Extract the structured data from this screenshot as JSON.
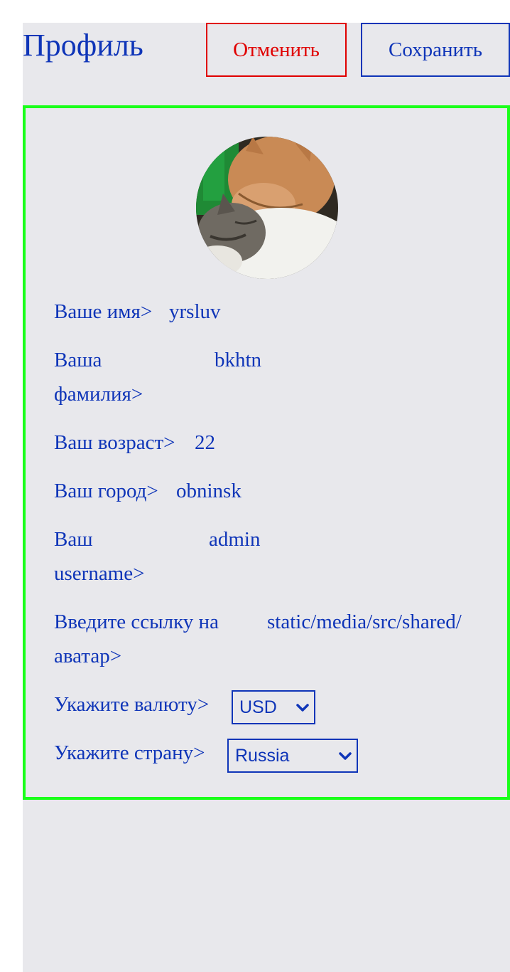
{
  "header": {
    "title": "Профиль",
    "cancel_label": "Отменить",
    "save_label": "Сохранить"
  },
  "colors": {
    "accent": "#0f35b8",
    "cancel": "#e00000",
    "card_border": "#1aff1a",
    "background": "#e8e8ec"
  },
  "profile": {
    "avatar_alt": "cats-avatar",
    "fields": [
      {
        "label": "Ваше имя>",
        "value": "yrsluv"
      },
      {
        "label_line1": "Ваша",
        "label_line2": "фамилия>",
        "value": "bkhtn"
      },
      {
        "label": "Ваш возраст>",
        "value": "22"
      },
      {
        "label": "Ваш город>",
        "value": "obninsk"
      },
      {
        "label_line1": "Ваш",
        "label_line2": "username>",
        "value": "admin"
      },
      {
        "label_line1": "Введите ссылку на",
        "label_line2": "аватар>",
        "value": "static/media/src/shared/"
      }
    ],
    "currency": {
      "label": "Укажите валюту>",
      "selected": "USD"
    },
    "country": {
      "label": "Укажите страну>",
      "selected": "Russia"
    }
  }
}
